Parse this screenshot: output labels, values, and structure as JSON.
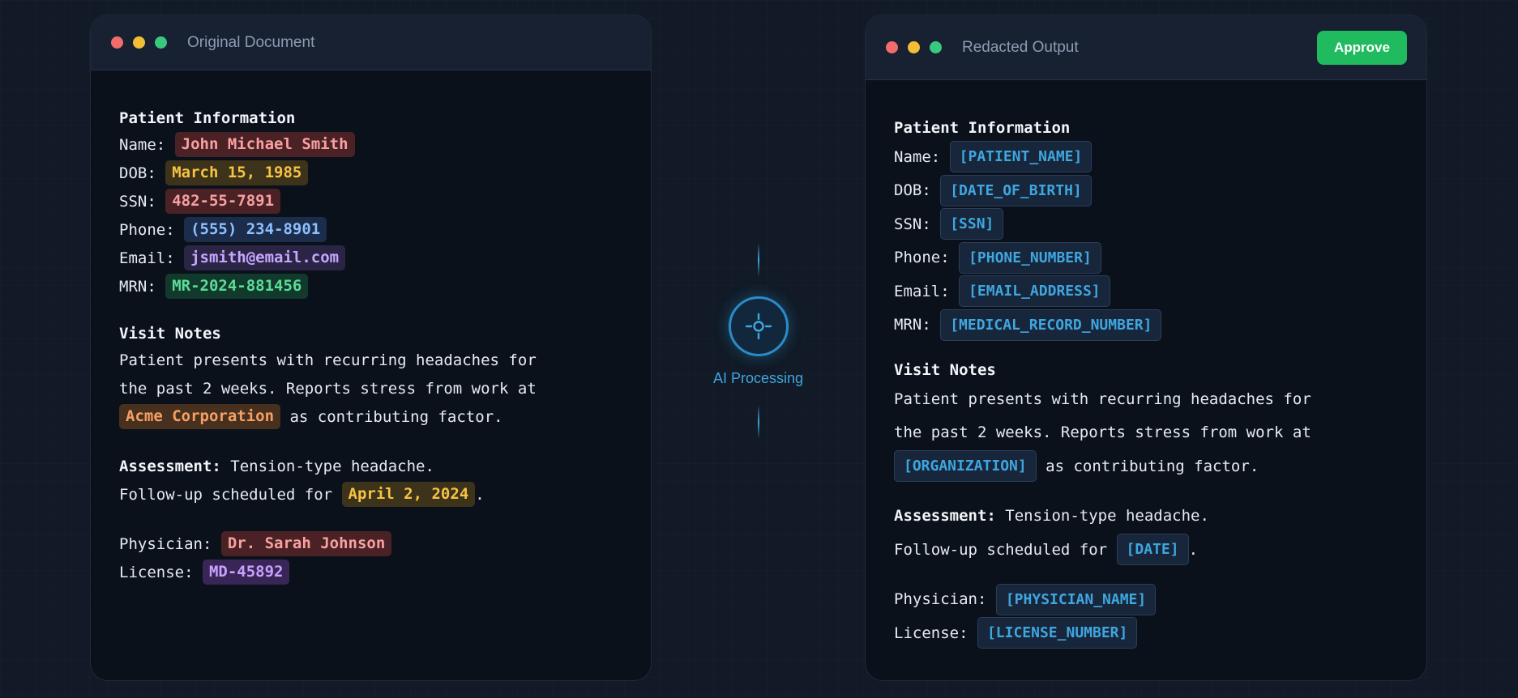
{
  "left_window": {
    "title": "Original Document",
    "patient_heading": "Patient Information",
    "fields": [
      {
        "label": "Name: ",
        "value": "John Michael Smith"
      },
      {
        "label": "DOB: ",
        "value": "March 15, 1985"
      },
      {
        "label": "SSN: ",
        "value": "482-55-7891"
      },
      {
        "label": "Phone: ",
        "value": "(555) 234-8901"
      },
      {
        "label": "Email: ",
        "value": "jsmith@email.com"
      },
      {
        "label": "MRN: ",
        "value": "MR-2024-881456"
      }
    ],
    "visit_heading": "Visit Notes",
    "notes_line1": "Patient presents with recurring headaches for",
    "notes_line2": "the past 2 weeks. Reports stress from work at",
    "organization": "Acme Corporation",
    "notes_line3_suffix": " as contributing factor.",
    "assessment_label": "Assessment:",
    "assessment_text": " Tension-type headache.",
    "followup_text": "Follow-up scheduled for ",
    "followup_date": "April 2, 2024",
    "followup_suffix": ".",
    "physician_label": "Physician: ",
    "physician_value": "Dr. Sarah Johnson",
    "license_label": "License: ",
    "license_value": "MD-45892"
  },
  "center": {
    "label": "AI Processing",
    "icon": "crosshair-icon"
  },
  "right_window": {
    "title": "Redacted Output",
    "approve_label": "Approve",
    "patient_heading": "Patient Information",
    "fields": [
      {
        "label": "Name: ",
        "value": "[PATIENT_NAME]"
      },
      {
        "label": "DOB: ",
        "value": "[DATE_OF_BIRTH]"
      },
      {
        "label": "SSN: ",
        "value": "[SSN]"
      },
      {
        "label": "Phone: ",
        "value": "[PHONE_NUMBER]"
      },
      {
        "label": "Email: ",
        "value": "[EMAIL_ADDRESS]"
      },
      {
        "label": "MRN: ",
        "value": "[MEDICAL_RECORD_NUMBER]"
      }
    ],
    "visit_heading": "Visit Notes",
    "notes_line1": "Patient presents with recurring headaches for",
    "notes_line2": "the past 2 weeks. Reports stress from work at",
    "organization": "[ORGANIZATION]",
    "notes_line3_suffix": " as contributing factor.",
    "assessment_label": "Assessment:",
    "assessment_text": " Tension-type headache.",
    "followup_text": "Follow-up scheduled for ",
    "followup_date": "[DATE]",
    "followup_suffix": ".",
    "physician_label": "Physician: ",
    "physician_value": "[PHYSICIAN_NAME]",
    "license_label": "License: ",
    "license_value": "[LICENSE_NUMBER]"
  },
  "colors": {
    "background": "#111a26",
    "panel": "#0b111b",
    "accent": "#3fa6e0",
    "approve": "#1fbb5e"
  }
}
